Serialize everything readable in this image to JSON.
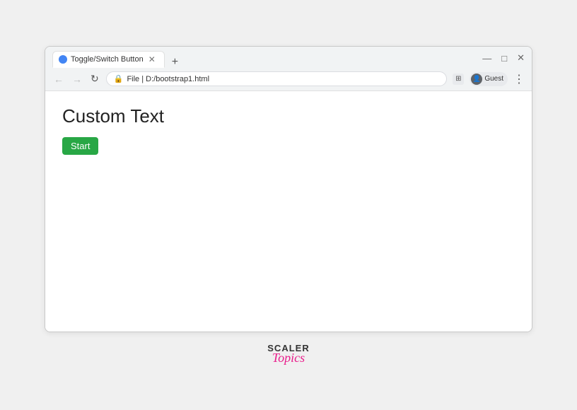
{
  "browser": {
    "tab": {
      "title": "Toggle/Switch Button",
      "favicon": "circle"
    },
    "address": {
      "lock_icon": "🔒",
      "url": "D:/bootstrap1.html",
      "file_prefix": "File"
    },
    "profile": {
      "label": "Guest"
    },
    "controls": {
      "minimize": "—",
      "maximize": "□",
      "close": "✕",
      "back": "←",
      "forward": "→",
      "refresh": "↻",
      "menu": "⋮"
    }
  },
  "page": {
    "heading": "Custom Text",
    "start_button": "Start"
  },
  "brand": {
    "name": "SCALER",
    "tagline": "Topics"
  }
}
